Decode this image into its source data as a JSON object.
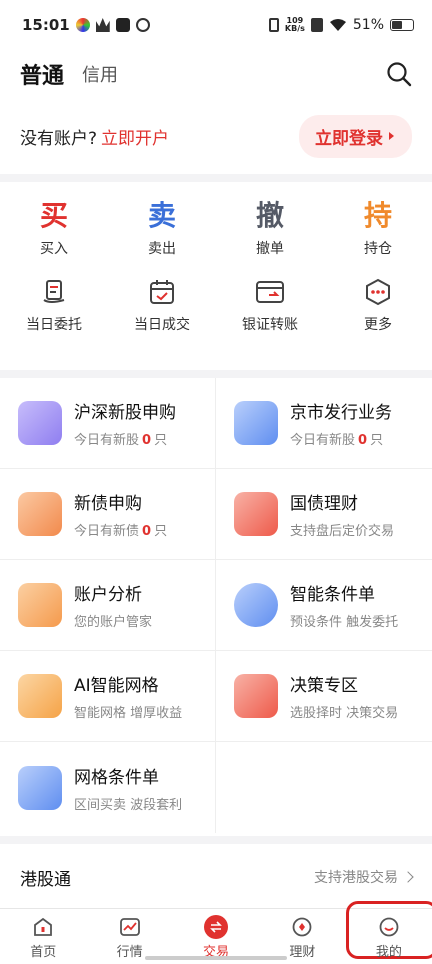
{
  "status_bar": {
    "time": "15:01",
    "net_speed_value": "109",
    "net_speed_unit": "KB/s",
    "battery": "51%",
    "battery_level": 0.51
  },
  "header": {
    "tab_normal": "普通",
    "tab_credit": "信用"
  },
  "account": {
    "no_account_text": "没有账户?",
    "open_link": "立即开户",
    "login_button": "立即登录"
  },
  "actions_primary": [
    {
      "char": "买",
      "label": "买入",
      "color": "#e0322f"
    },
    {
      "char": "卖",
      "label": "卖出",
      "color": "#3a6fd8"
    },
    {
      "char": "撤",
      "label": "撤单",
      "color": "#555a66"
    },
    {
      "char": "持",
      "label": "持仓",
      "color": "#f08a2c"
    }
  ],
  "actions_secondary": [
    {
      "label": "当日委托",
      "icon": "document-hand-icon"
    },
    {
      "label": "当日成交",
      "icon": "calendar-check-icon"
    },
    {
      "label": "银证转账",
      "icon": "transfer-card-icon"
    },
    {
      "label": "更多",
      "icon": "more-hexagon-icon"
    }
  ],
  "services": [
    {
      "title": "沪深新股申购",
      "sub_prefix": "今日有新股",
      "num": "0",
      "sub_suffix": "只",
      "icon": "ipo-calendar-icon",
      "color": "#9b8cf0"
    },
    {
      "title": "京市发行业务",
      "sub_prefix": "今日有新股",
      "num": "0",
      "sub_suffix": "只",
      "icon": "bar-calendar-icon",
      "color": "#5f8ef0"
    },
    {
      "title": "新债申购",
      "sub_prefix": "今日有新债",
      "num": "0",
      "sub_suffix": "只",
      "icon": "bond-bag-icon",
      "color": "#f28a4c"
    },
    {
      "title": "国债理财",
      "sub": "支持盘后定价交易",
      "icon": "treasury-card-icon",
      "color": "#ee5a4a"
    },
    {
      "title": "账户分析",
      "sub": "您的账户管家",
      "icon": "wallet-icon",
      "color": "#f59a4c"
    },
    {
      "title": "智能条件单",
      "sub": "预设条件 触发委托",
      "icon": "clock-icon",
      "color": "#5f8ef0"
    },
    {
      "title": "AI智能网格",
      "sub": "智能网格 增厚收益",
      "icon": "ai-grid-icon",
      "color": "#f5a347"
    },
    {
      "title": "决策专区",
      "sub": "选股择时 决策交易",
      "icon": "lightbulb-icon",
      "color": "#ee5a4a"
    },
    {
      "title": "网格条件单",
      "sub": "区间买卖 波段套利",
      "icon": "grid-order-icon",
      "color": "#5f8ef0"
    }
  ],
  "hk": {
    "title": "港股通",
    "link": "支持港股交易"
  },
  "tabbar": [
    {
      "label": "首页",
      "icon": "home-icon"
    },
    {
      "label": "行情",
      "icon": "chart-icon"
    },
    {
      "label": "交易",
      "icon": "trade-icon"
    },
    {
      "label": "理财",
      "icon": "wealth-icon"
    },
    {
      "label": "我的",
      "icon": "profile-icon"
    }
  ]
}
